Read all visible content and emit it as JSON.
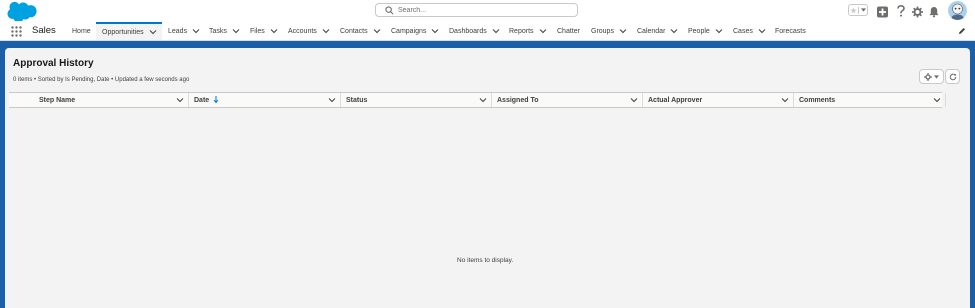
{
  "header": {
    "search_placeholder": "Search..."
  },
  "nav": {
    "app_name": "Sales",
    "tabs": [
      {
        "label": "Home"
      },
      {
        "label": "Opportunities"
      },
      {
        "label": "Leads"
      },
      {
        "label": "Tasks"
      },
      {
        "label": "Files"
      },
      {
        "label": "Accounts"
      },
      {
        "label": "Contacts"
      },
      {
        "label": "Campaigns"
      },
      {
        "label": "Dashboards"
      },
      {
        "label": "Reports"
      },
      {
        "label": "Chatter"
      },
      {
        "label": "Groups"
      },
      {
        "label": "Calendar"
      },
      {
        "label": "People"
      },
      {
        "label": "Cases"
      },
      {
        "label": "Forecasts"
      }
    ],
    "active_tab": "Opportunities"
  },
  "page": {
    "title": "Approval History",
    "meta": "0 items • Sorted by Is Pending, Date • Updated a few seconds ago"
  },
  "table": {
    "columns": [
      {
        "label": "Step Name"
      },
      {
        "label": "Date"
      },
      {
        "label": "Status"
      },
      {
        "label": "Assigned To"
      },
      {
        "label": "Actual Approver"
      },
      {
        "label": "Comments"
      }
    ],
    "empty_message": "No items to display."
  },
  "colors": {
    "brand_blue": "#0176d3",
    "background_blue": "#1b5fa8",
    "salesforce_cloud": "#00a1e0"
  },
  "icons": [
    "salesforce-logo",
    "search-icon",
    "star-icon",
    "add-icon",
    "help-icon",
    "setup-gear-icon",
    "bell-icon",
    "app-launcher-icon",
    "chevron-down-icon",
    "pencil-icon",
    "gear-icon",
    "refresh-icon",
    "sort-down-arrow-icon"
  ]
}
